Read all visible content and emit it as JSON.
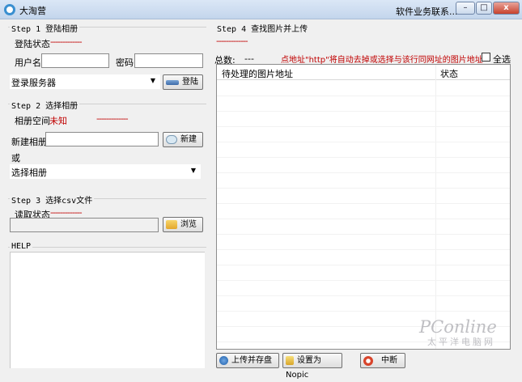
{
  "window": {
    "title": "大淘营",
    "right_label": "软件业务联系...",
    "minimize": "–",
    "maximize": "□",
    "close": "x"
  },
  "step1": {
    "legend": "Step 1 登陆相册",
    "login_status_label": "登陆状态",
    "login_status_value": "-------------",
    "username_label": "用户名",
    "username_value": "",
    "password_label": "密码",
    "password_value": "",
    "server_value": "登录服务器",
    "login_button": "登陆"
  },
  "step2": {
    "legend": "Step 2 选择相册",
    "album_space_label": "相册空间",
    "album_space_value": "未知",
    "album_space_dash": "-------------",
    "new_album_label": "新建相册",
    "new_album_value": "",
    "new_button": "新建",
    "or_label": "或",
    "select_album_value": "选择相册"
  },
  "step3": {
    "legend": "Step 3 选择csv文件",
    "read_status_label": "读取状态",
    "read_status_value": "-------------",
    "file_value": "",
    "browse_button": "浏览"
  },
  "help": {
    "legend": "HELP"
  },
  "step4": {
    "legend": "Step 4 查找图片并上传",
    "status_dash": "-------------",
    "total_label": "总数:",
    "total_value": "---",
    "hint": "点地址\"http\"将自动去掉或选择与该行同网址的图片地址",
    "select_all_label": "全选",
    "select_all_checked": false,
    "table": {
      "columns": [
        "待处理的图片地址",
        "状态"
      ],
      "rows": []
    },
    "upload_button": "上传并存盘",
    "nopic_button": "设置为Nopic",
    "stop_button": "中断"
  },
  "colors": {
    "status_red": "#c00000",
    "title_gradient_top": "#dbe7f6",
    "close_red": "#c7412d"
  },
  "watermark": {
    "brand": "PConline",
    "sub": "太平洋电脑网"
  }
}
